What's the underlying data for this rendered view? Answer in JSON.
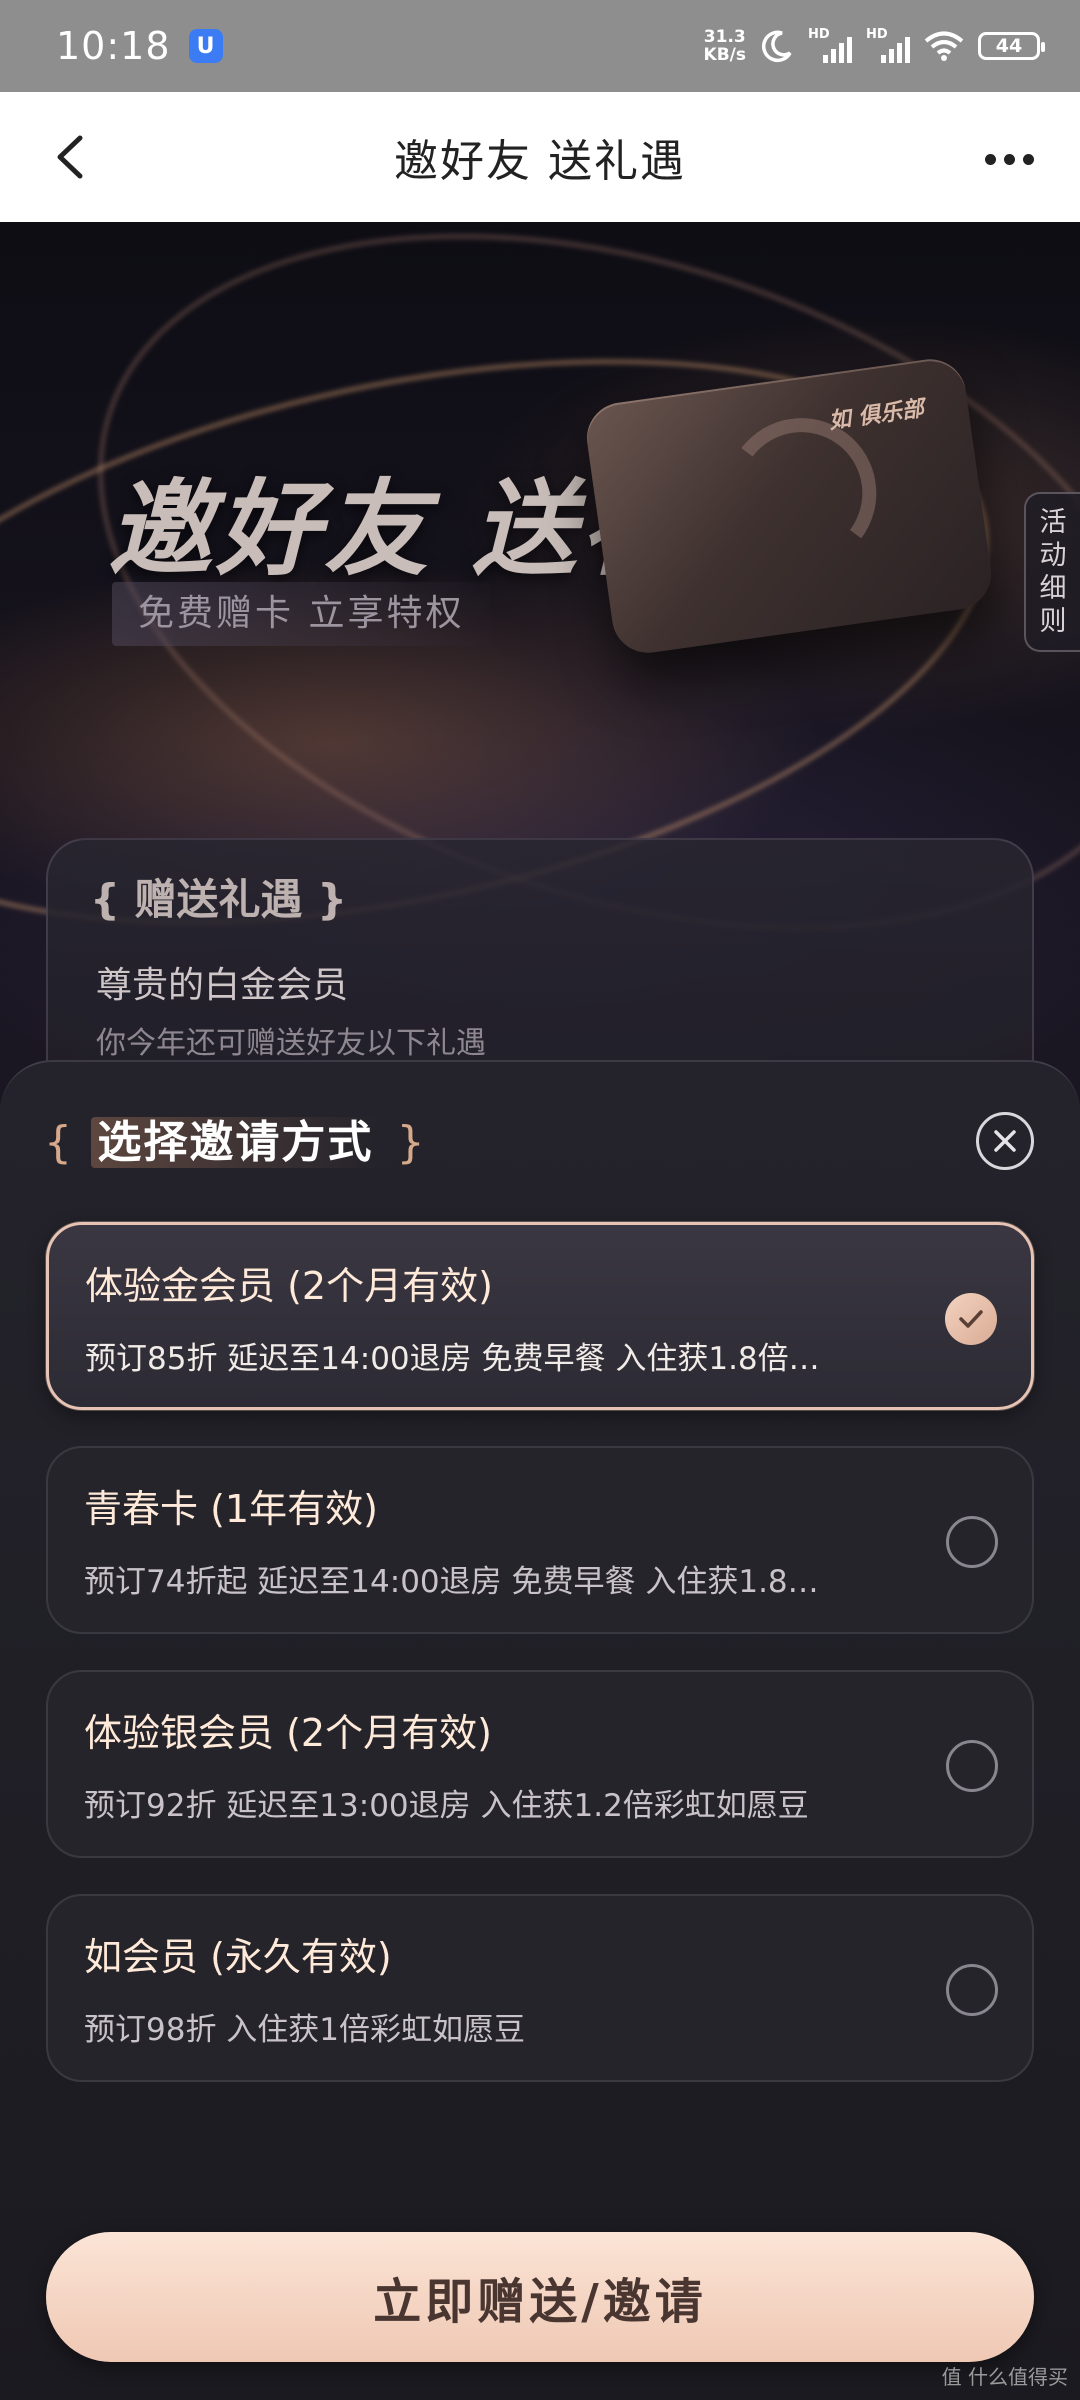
{
  "status_bar": {
    "time": "10:18",
    "app_badge": "U",
    "net_speed_value": "31.3",
    "net_speed_unit": "KB/s",
    "signal1_label": "HD",
    "signal2_label": "HD",
    "battery": "44"
  },
  "nav": {
    "title": "邀好友 送礼遇"
  },
  "hero": {
    "title": "邀好友 送礼遇",
    "subtitle": "免费赠卡 立享特权",
    "card_logo": "如 俱乐部",
    "rules_tab": [
      "活",
      "动",
      "细",
      "则"
    ]
  },
  "gift_panel": {
    "title": "{ 赠送礼遇 }",
    "line1": "尊贵的白金会员",
    "line2": "你今年还可赠送好友以下礼遇"
  },
  "sheet": {
    "title_open": "{",
    "title": "选择邀请方式",
    "title_close": "}",
    "options": [
      {
        "title": "体验金会员 (2个月有效)",
        "desc": "预订85折 延迟至14:00退房 免费早餐 入住获1.8倍…",
        "selected": true
      },
      {
        "title": "青春卡 (1年有效)",
        "desc": "预订74折起 延迟至14:00退房 免费早餐 入住获1.8…",
        "selected": false
      },
      {
        "title": "体验银会员 (2个月有效)",
        "desc": "预订92折 延迟至13:00退房 入住获1.2倍彩虹如愿豆",
        "selected": false
      },
      {
        "title": "如会员 (永久有效)",
        "desc": "预订98折 入住获1倍彩虹如愿豆",
        "selected": false
      }
    ],
    "cta": "立即赠送/邀请"
  },
  "watermark": "值 什么值得买",
  "colors": {
    "accent": "#efc8b4",
    "selected_border": "#e6c3b2",
    "sheet_bg": "#24232b"
  }
}
